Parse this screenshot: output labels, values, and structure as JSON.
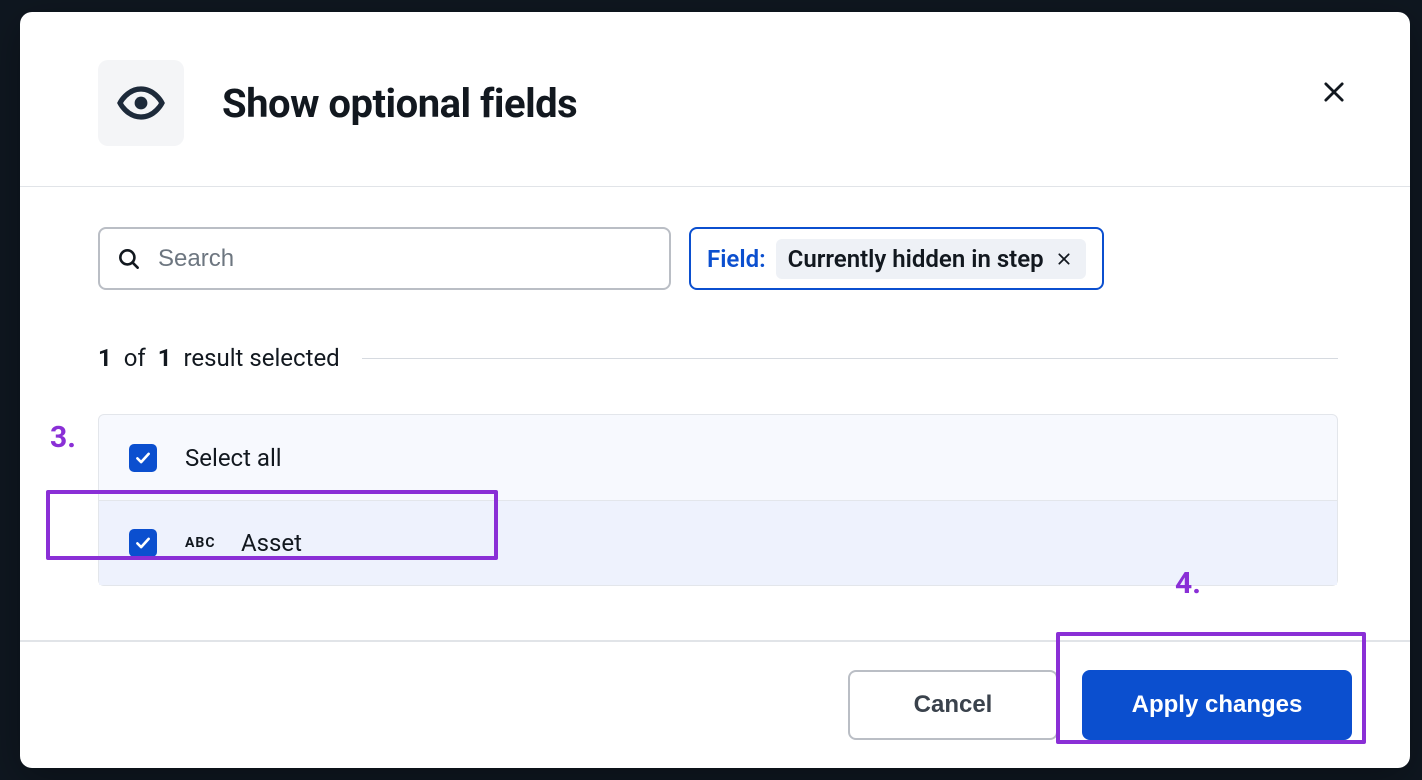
{
  "modal": {
    "title": "Show optional fields",
    "search_placeholder": "Search",
    "filter": {
      "label": "Field:",
      "value": "Currently hidden in step"
    },
    "results": {
      "selected": "1",
      "of_word": "of",
      "total": "1",
      "suffix": "result selected"
    },
    "select_all_label": "Select all",
    "items": [
      {
        "type_label": "ABC",
        "name": "Asset"
      }
    ],
    "buttons": {
      "cancel": "Cancel",
      "apply": "Apply changes"
    }
  },
  "annotations": {
    "a3": "3.",
    "a4": "4."
  }
}
